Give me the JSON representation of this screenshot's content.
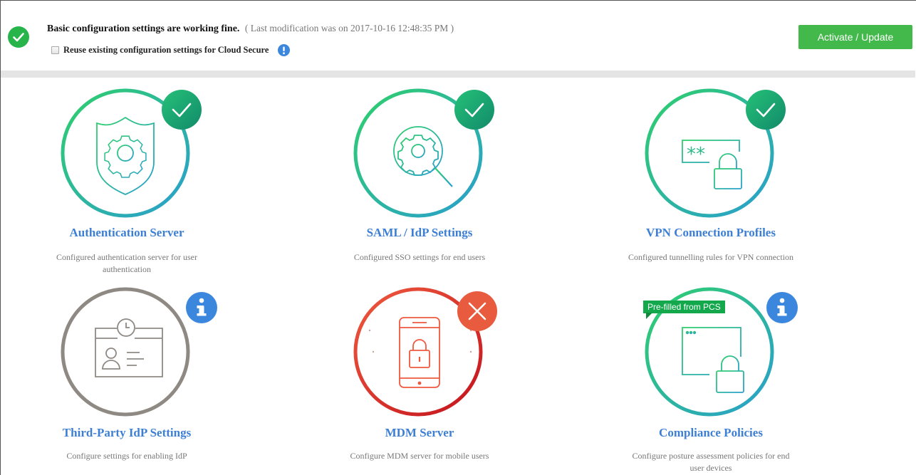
{
  "status": {
    "message": "Basic configuration settings are working fine.",
    "modification": "( Last modification was on 2017-10-16 12:48:35 PM )",
    "reuse_label": "Reuse existing configuration settings for Cloud Secure",
    "reuse_checked": false,
    "activate_label": "Activate / Update",
    "ok_icon": "check-circle-icon",
    "info_icon": "info-circle-icon"
  },
  "colors": {
    "success": "#27b44a",
    "button": "#43b84b",
    "link": "#3d7fd4",
    "error": "#e0463a",
    "info": "#3b87dd",
    "neutral": "#8f8984"
  },
  "tiles": [
    {
      "title": "Authentication Server",
      "desc": "Configured authentication server for user authentication",
      "state": "configured",
      "icon": "shield-gear-icon"
    },
    {
      "title": "SAML / IdP Settings",
      "desc": "Configured SSO settings for end users",
      "state": "configured",
      "icon": "gear-magnifier-icon"
    },
    {
      "title": "VPN Connection Profiles",
      "desc": "Configured tunnelling rules for VPN connection",
      "state": "configured",
      "icon": "password-lock-icon"
    },
    {
      "title": "Third-Party IdP Settings",
      "desc": "Configure settings for enabling IdP",
      "state": "info",
      "icon": "id-card-clock-icon"
    },
    {
      "title": "MDM Server",
      "desc": "Configure MDM server for mobile users",
      "state": "error",
      "icon": "phone-lock-icon"
    },
    {
      "title": "Compliance Policies",
      "desc": "Configure posture assessment policies for end user devices",
      "state": "info",
      "icon": "window-lock-icon",
      "badge": "Pre-filled from PCS"
    }
  ]
}
